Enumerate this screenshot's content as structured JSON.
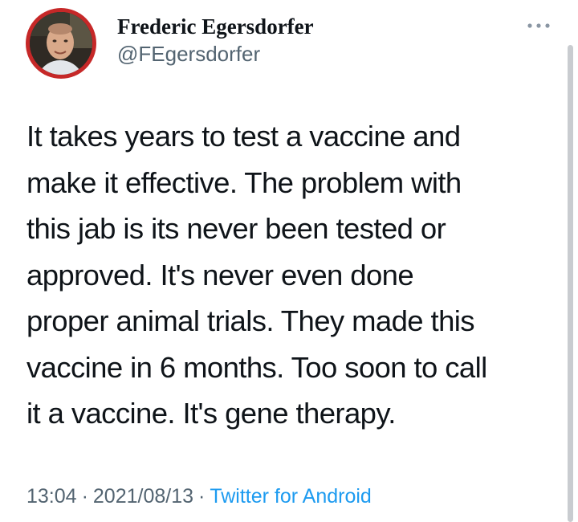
{
  "author": {
    "display_name": "Frederic Egersdorfer",
    "handle": "@FEgersdorfer",
    "avatar_icon": "profile-photo"
  },
  "tweet": {
    "text": "It takes years to test a vaccine and\nmake it effective. The problem with\nthis jab is its never been tested or\napproved. It's never even done\nproper animal trials. They made this\nvaccine in 6 months. Too soon to call\nit a vaccine. It's gene therapy.",
    "time": "13:04",
    "separator": "·",
    "date": "2021/08/13",
    "source": "Twitter for Android"
  },
  "more_icon": "more-dots-icon",
  "colors": {
    "text": "#0f1419",
    "secondary": "#536471",
    "link": "#1d9bf0",
    "avatar_ring": "#c62828"
  }
}
